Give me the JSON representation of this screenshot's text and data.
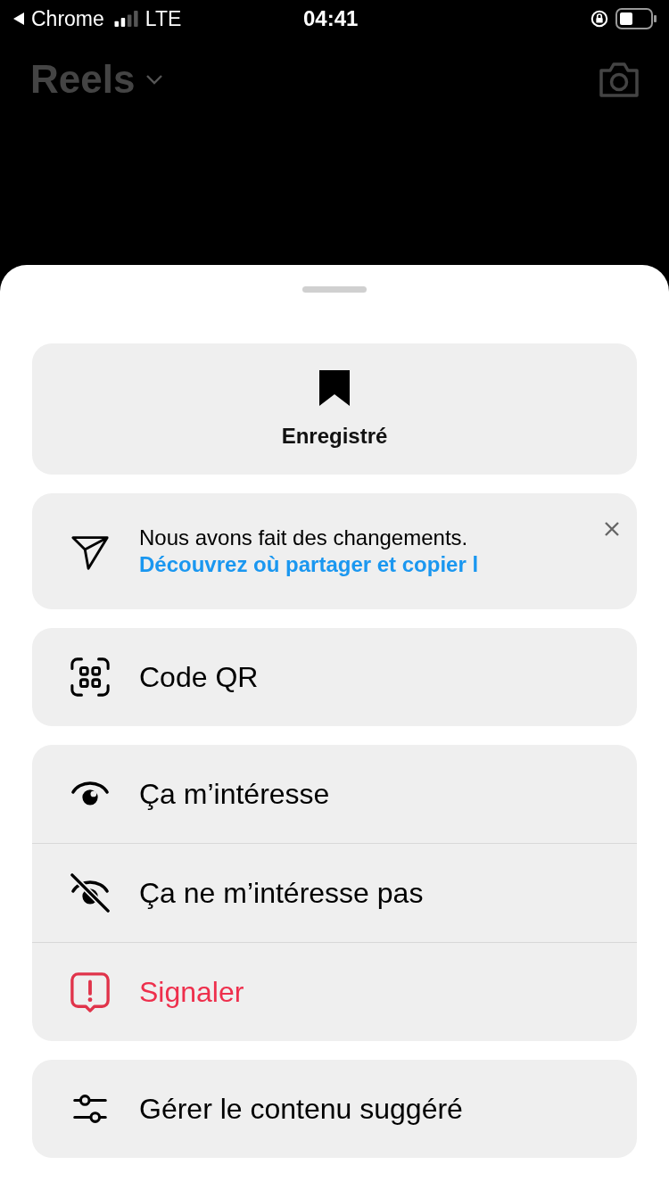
{
  "status_bar": {
    "back_app": "Chrome",
    "network": "LTE",
    "time": "04:41"
  },
  "header": {
    "title": "Reels"
  },
  "sheet": {
    "saved_button": {
      "label": "Enregistré"
    },
    "notice": {
      "text": "Nous avons fait des changements.",
      "link": "Découvrez où partager et copier l"
    },
    "qr_item": {
      "label": "Code QR"
    },
    "feedback_items": [
      {
        "label": "Ça m’intéresse",
        "kind": "normal"
      },
      {
        "label": "Ça ne m’intéresse pas",
        "kind": "normal"
      },
      {
        "label": "Signaler",
        "kind": "danger"
      }
    ],
    "manage_item": {
      "label": "Gérer le contenu suggéré"
    }
  }
}
